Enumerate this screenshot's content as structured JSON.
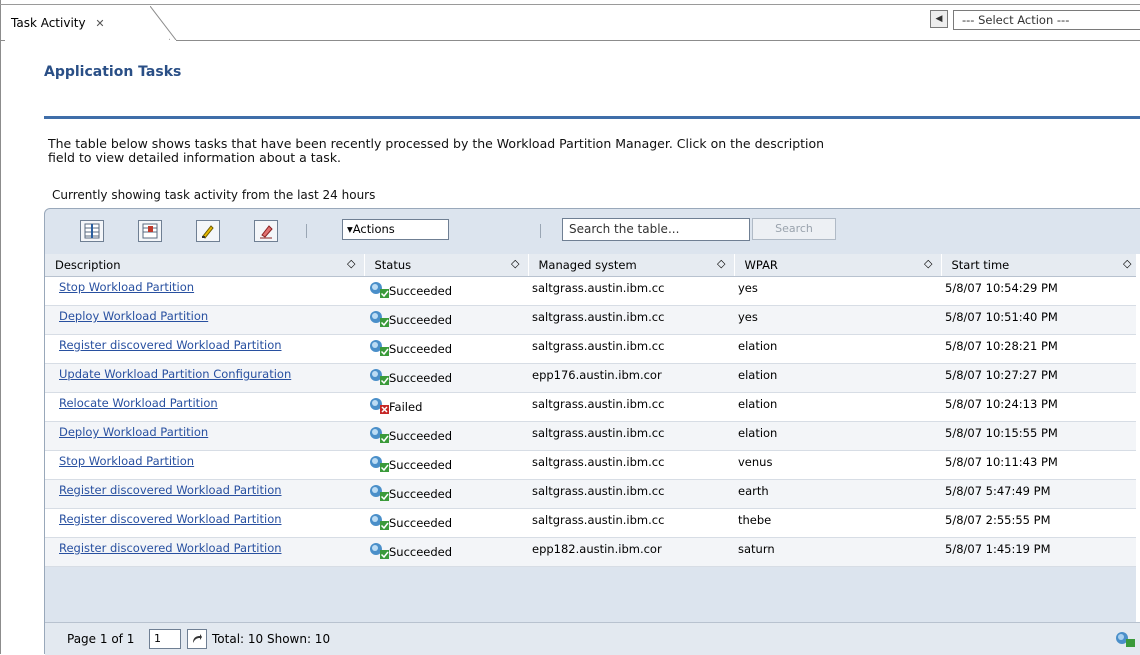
{
  "tab": {
    "label": "Task Activity",
    "close_glyph": "✕"
  },
  "select_action": {
    "label": "--- Select Action ---"
  },
  "page_title": "Application Tasks",
  "description": {
    "line1": "The table below shows tasks that have been recently processed by the Workload Partition Manager. Click on the description",
    "line2": "field to view detailed information about a task."
  },
  "showing_text": "Currently showing task activity from the last 24 hours",
  "toolbar": {
    "actions_label": "▾Actions",
    "search_placeholder": "Search the table...",
    "search_button": "Search",
    "icons": [
      "select-all-icon",
      "deselect-all-icon",
      "edit-icon",
      "clear-icon"
    ]
  },
  "columns": [
    "Description",
    "Status",
    "Managed system",
    "WPAR",
    "Start time"
  ],
  "rows": [
    {
      "desc": "Stop Workload Partition",
      "status": "Succeeded",
      "system": "saltgrass.austin.ibm.cc",
      "wpar": "yes",
      "start": "5/8/07 10:54:29 PM"
    },
    {
      "desc": "Deploy Workload Partition",
      "status": "Succeeded",
      "system": "saltgrass.austin.ibm.cc",
      "wpar": "yes",
      "start": "5/8/07 10:51:40 PM"
    },
    {
      "desc": "Register discovered Workload Partition",
      "status": "Succeeded",
      "system": "saltgrass.austin.ibm.cc",
      "wpar": "elation",
      "start": "5/8/07 10:28:21 PM"
    },
    {
      "desc": "Update Workload Partition Configuration",
      "status": "Succeeded",
      "system": "epp176.austin.ibm.cor",
      "wpar": "elation",
      "start": "5/8/07 10:27:27 PM"
    },
    {
      "desc": "Relocate Workload Partition",
      "status": "Failed",
      "system": "saltgrass.austin.ibm.cc",
      "wpar": "elation",
      "start": "5/8/07 10:24:13 PM"
    },
    {
      "desc": "Deploy Workload Partition",
      "status": "Succeeded",
      "system": "saltgrass.austin.ibm.cc",
      "wpar": "elation",
      "start": "5/8/07 10:15:55 PM"
    },
    {
      "desc": "Stop Workload Partition",
      "status": "Succeeded",
      "system": "saltgrass.austin.ibm.cc",
      "wpar": "venus",
      "start": "5/8/07 10:11:43 PM"
    },
    {
      "desc": "Register discovered Workload Partition",
      "status": "Succeeded",
      "system": "saltgrass.austin.ibm.cc",
      "wpar": "earth",
      "start": "5/8/07 5:47:49 PM"
    },
    {
      "desc": "Register discovered Workload Partition",
      "status": "Succeeded",
      "system": "saltgrass.austin.ibm.cc",
      "wpar": "thebe",
      "start": "5/8/07 2:55:55 PM"
    },
    {
      "desc": "Register discovered Workload Partition",
      "status": "Succeeded",
      "system": "epp182.austin.ibm.cor",
      "wpar": "saturn",
      "start": "5/8/07 1:45:19 PM"
    }
  ],
  "footer": {
    "page_label": "Page 1 of 1",
    "page_value": "1",
    "total_label": "Total: 10 Shown: 10"
  },
  "colors": {
    "title": "#2a4f86",
    "rule": "#3f6ea9",
    "link": "#2850a0",
    "panel": "#dce4ee"
  }
}
